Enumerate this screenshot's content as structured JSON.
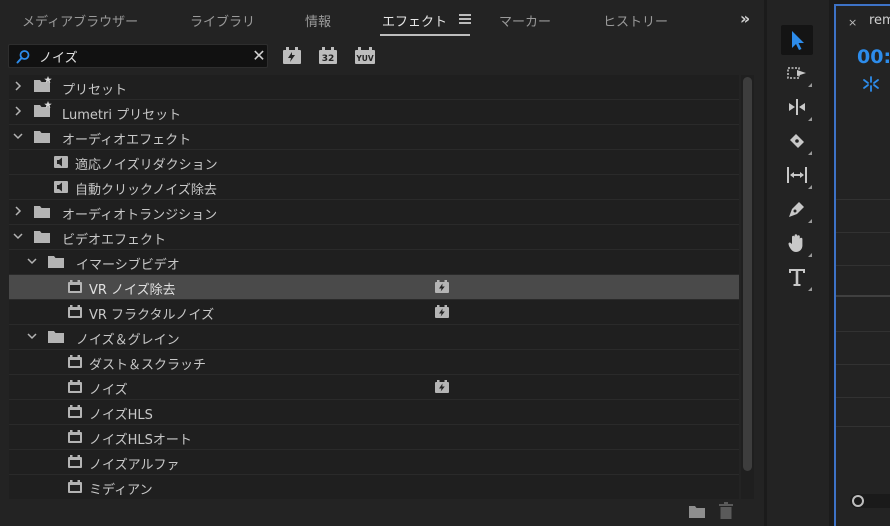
{
  "tabs": [
    {
      "label": "メディアブラウザー",
      "active": false
    },
    {
      "label": "ライブラリ",
      "active": false
    },
    {
      "label": "情報",
      "active": false
    },
    {
      "label": "エフェクト",
      "active": true
    },
    {
      "label": "マーカー",
      "active": false
    },
    {
      "label": "ヒストリー",
      "active": false
    }
  ],
  "search": {
    "value": "ノイズ",
    "placeholder": ""
  },
  "filters": {
    "accelerated": "accelerated-effects-icon",
    "bit32": "32",
    "yuv": "YUV"
  },
  "tree": [
    {
      "label": "プリセット",
      "type": "preset-folder",
      "level": 0,
      "expanded": false,
      "accelerated": false,
      "selected": false
    },
    {
      "label": "Lumetri プリセット",
      "type": "preset-folder",
      "level": 0,
      "expanded": false,
      "accelerated": false,
      "selected": false
    },
    {
      "label": "オーディオエフェクト",
      "type": "folder",
      "level": 0,
      "expanded": true,
      "accelerated": false,
      "selected": false
    },
    {
      "label": "適応ノイズリダクション",
      "type": "audio-effect",
      "level": 1,
      "accelerated": false,
      "selected": false
    },
    {
      "label": "自動クリックノイズ除去",
      "type": "audio-effect",
      "level": 1,
      "accelerated": false,
      "selected": false
    },
    {
      "label": "オーディオトランジション",
      "type": "folder",
      "level": 0,
      "expanded": false,
      "accelerated": false,
      "selected": false
    },
    {
      "label": "ビデオエフェクト",
      "type": "folder",
      "level": 0,
      "expanded": true,
      "accelerated": false,
      "selected": false
    },
    {
      "label": "イマーシブビデオ",
      "type": "folder",
      "level": 1,
      "expanded": true,
      "accelerated": false,
      "selected": false
    },
    {
      "label": "VR ノイズ除去",
      "type": "video-effect",
      "level": 2,
      "accelerated": true,
      "selected": true
    },
    {
      "label": "VR フラクタルノイズ",
      "type": "video-effect",
      "level": 2,
      "accelerated": true,
      "selected": false
    },
    {
      "label": "ノイズ＆グレイン",
      "type": "folder",
      "level": 1,
      "expanded": true,
      "accelerated": false,
      "selected": false
    },
    {
      "label": "ダスト＆スクラッチ",
      "type": "video-effect",
      "level": 2,
      "accelerated": false,
      "selected": false
    },
    {
      "label": "ノイズ",
      "type": "video-effect",
      "level": 2,
      "accelerated": true,
      "selected": false
    },
    {
      "label": "ノイズHLS",
      "type": "video-effect",
      "level": 2,
      "accelerated": false,
      "selected": false
    },
    {
      "label": "ノイズHLSオート",
      "type": "video-effect",
      "level": 2,
      "accelerated": false,
      "selected": false
    },
    {
      "label": "ノイズアルファ",
      "type": "video-effect",
      "level": 2,
      "accelerated": false,
      "selected": false
    },
    {
      "label": "ミディアン",
      "type": "video-effect",
      "level": 2,
      "accelerated": false,
      "selected": false
    }
  ],
  "tools": [
    {
      "name": "selection-tool-icon",
      "active": true
    },
    {
      "name": "track-select-forward-tool-icon",
      "active": false
    },
    {
      "name": "ripple-edit-tool-icon",
      "active": false
    },
    {
      "name": "razor-tool-icon",
      "active": false
    },
    {
      "name": "slip-tool-icon",
      "active": false
    },
    {
      "name": "pen-tool-icon",
      "active": false
    },
    {
      "name": "hand-tool-icon",
      "active": false
    },
    {
      "name": "type-tool-icon",
      "active": false
    }
  ],
  "timeline": {
    "close": "×",
    "tab_label": "rem",
    "timecode": "00:"
  },
  "colors": {
    "accent": "#2d8ceb",
    "panel_border": "#3d72c6",
    "selected_row": "#4a4a4a"
  }
}
